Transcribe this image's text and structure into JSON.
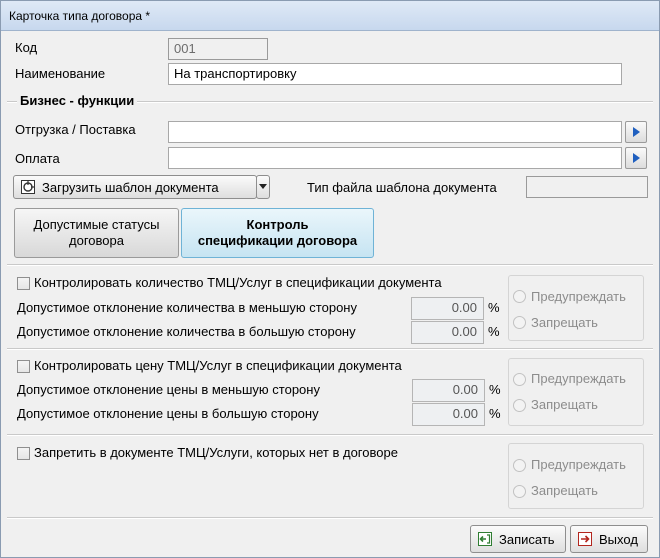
{
  "window": {
    "title": "Карточка типа договора *"
  },
  "fields": {
    "code": {
      "label": "Код",
      "value": "001"
    },
    "name": {
      "label": "Наименование",
      "value": "На транспортировку"
    }
  },
  "business": {
    "title": "Бизнес - функции",
    "shipment": {
      "label": "Отгрузка / Поставка",
      "value": ""
    },
    "payment": {
      "label": "Оплата",
      "value": ""
    }
  },
  "template": {
    "load_label": "Загрузить шаблон документа",
    "file_type_label": "Тип файла шаблона документа",
    "file_type_value": ""
  },
  "tabs": [
    {
      "label": "Допустимые статусы договора",
      "active": false
    },
    {
      "label": "Контроль спецификации договора",
      "active": true
    }
  ],
  "quantity": {
    "check_label": "Контролировать количество ТМЦ/Услуг в спецификации документа",
    "less_label": "Допустимое отклонение количества в меньшую сторону",
    "less_value": "0.00",
    "more_label": "Допустимое отклонение количества в большую сторону",
    "more_value": "0.00",
    "unit": "%",
    "warn": "Предупреждать",
    "forbid": "Запрещать"
  },
  "price": {
    "check_label": "Контролировать цену ТМЦ/Услуг в спецификации документа",
    "less_label": "Допустимое отклонение цены в меньшую сторону",
    "less_value": "0.00",
    "more_label": "Допустимое отклонение цены в большую сторону",
    "more_value": "0.00",
    "unit": "%",
    "warn": "Предупреждать",
    "forbid": "Запрещать"
  },
  "absent": {
    "check_label": "Запретить в документе ТМЦ/Услуги, которых нет в договоре",
    "warn": "Предупреждать",
    "forbid": "Запрещать"
  },
  "footer": {
    "save": "Записать",
    "exit": "Выход"
  },
  "colors": {
    "accent_tab": "#c6e4f2",
    "title_bar": "#c7d8ee",
    "arrow_blue": "#1f5fbf"
  }
}
